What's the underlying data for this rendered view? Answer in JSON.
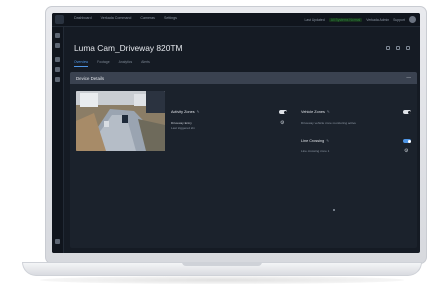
{
  "topbar": {
    "nav_links": [
      "Dashboard",
      "Verkada Command",
      "Cameras",
      "Settings"
    ],
    "right_items": [
      "Last Updated",
      "All Systems Normal",
      "Verkada Admin",
      "Support"
    ]
  },
  "device": {
    "title": "Luma Cam_Driveway 820TM",
    "tabs": [
      "Overview",
      "Footage",
      "Analytics",
      "Alerts"
    ],
    "active_tab_index": 0
  },
  "panel": {
    "title": "Device Details",
    "activity_zones": {
      "label": "Activity Zones",
      "name": "Driveway Entry",
      "sub": "Last triggered 2m"
    },
    "vehicle_zones": {
      "label": "Vehicle Zones",
      "sub": "Driveway vehicle zone monitoring active"
    },
    "line_crossing": {
      "label": "Line Crossing",
      "sub": "Line crossing zone 1"
    }
  },
  "colors": {
    "accent": "#4f96e6",
    "panel_bg": "#1b222c",
    "screen_bg": "#151b24"
  }
}
